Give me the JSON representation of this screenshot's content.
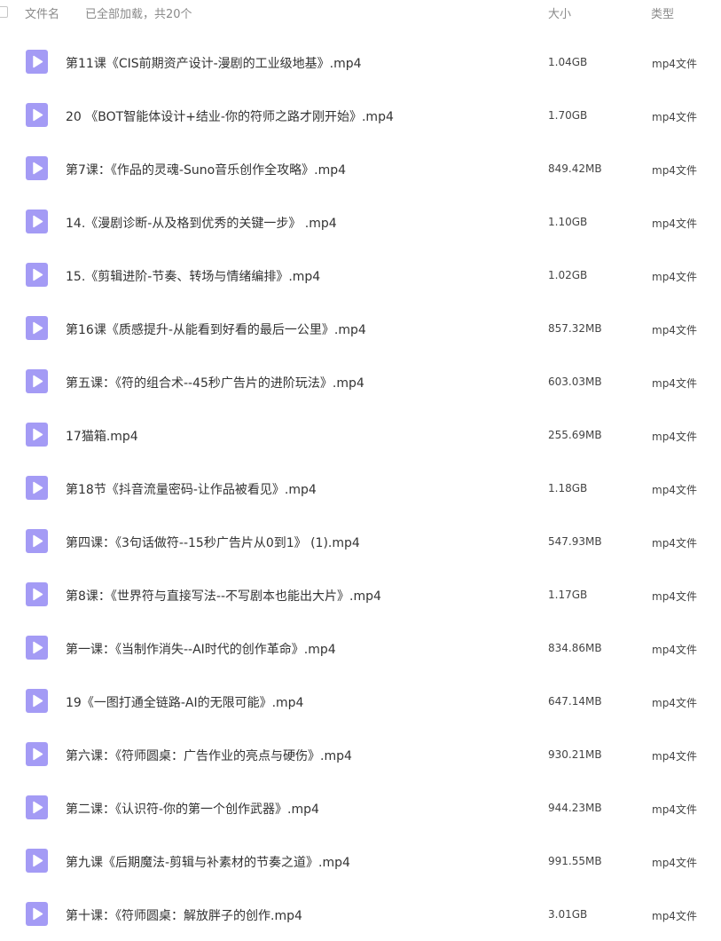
{
  "header": {
    "col_name": "文件名",
    "loaded_status": "已全部加载，共20个",
    "col_size": "大小",
    "col_type": "类型"
  },
  "colors": {
    "icon_fill": "#a49bf5",
    "icon_play": "#ffffff",
    "text": "#333333",
    "header_text": "#8a8a8a"
  },
  "files": [
    {
      "name": "第11课《CIS前期资产设计-漫剧的工业级地基》.mp4",
      "size": "1.04GB",
      "type": "mp4文件",
      "icon": "video-file-icon"
    },
    {
      "name": "20 《BOT智能体设计+结业-你的符师之路才刚开始》.mp4",
      "size": "1.70GB",
      "type": "mp4文件",
      "icon": "video-file-icon"
    },
    {
      "name": "第7课：《作品的灵魂-Suno音乐创作全攻略》.mp4",
      "size": "849.42MB",
      "type": "mp4文件",
      "icon": "video-file-icon"
    },
    {
      "name": "14.《漫剧诊断-从及格到优秀的关键一步》 .mp4",
      "size": "1.10GB",
      "type": "mp4文件",
      "icon": "video-file-icon"
    },
    {
      "name": "15.《剪辑进阶-节奏、转场与情绪编排》.mp4",
      "size": "1.02GB",
      "type": "mp4文件",
      "icon": "video-file-icon"
    },
    {
      "name": "第16课《质感提升-从能看到好看的最后一公里》.mp4",
      "size": "857.32MB",
      "type": "mp4文件",
      "icon": "video-file-icon"
    },
    {
      "name": "第五课：《符的组合术--45秒广告片的进阶玩法》.mp4",
      "size": "603.03MB",
      "type": "mp4文件",
      "icon": "video-file-icon"
    },
    {
      "name": "17猫箱.mp4",
      "size": "255.69MB",
      "type": "mp4文件",
      "icon": "video-file-icon"
    },
    {
      "name": "第18节《抖音流量密码-让作品被看见》.mp4",
      "size": "1.18GB",
      "type": "mp4文件",
      "icon": "video-file-icon"
    },
    {
      "name": "第四课：《3句话做符--15秒广告片从0到1》 (1).mp4",
      "size": "547.93MB",
      "type": "mp4文件",
      "icon": "video-file-icon"
    },
    {
      "name": "第8课：《世界符与直接写法--不写剧本也能出大片》.mp4",
      "size": "1.17GB",
      "type": "mp4文件",
      "icon": "video-file-icon"
    },
    {
      "name": "第一课：《当制作消失--AI时代的创作革命》.mp4",
      "size": "834.86MB",
      "type": "mp4文件",
      "icon": "video-file-icon"
    },
    {
      "name": "19《一图打通全链路-AI的无限可能》.mp4",
      "size": "647.14MB",
      "type": "mp4文件",
      "icon": "video-file-icon"
    },
    {
      "name": "第六课：《符师圆桌：广告作业的亮点与硬伤》.mp4",
      "size": "930.21MB",
      "type": "mp4文件",
      "icon": "video-file-icon"
    },
    {
      "name": "第二课：《认识符-你的第一个创作武器》.mp4",
      "size": "944.23MB",
      "type": "mp4文件",
      "icon": "video-file-icon"
    },
    {
      "name": "第九课《后期魔法-剪辑与补素材的节奏之道》.mp4",
      "size": "991.55MB",
      "type": "mp4文件",
      "icon": "video-file-icon"
    },
    {
      "name": "第十课：《符师圆桌：解放胖子的创作.mp4",
      "size": "3.01GB",
      "type": "mp4文件",
      "icon": "video-file-icon"
    }
  ]
}
